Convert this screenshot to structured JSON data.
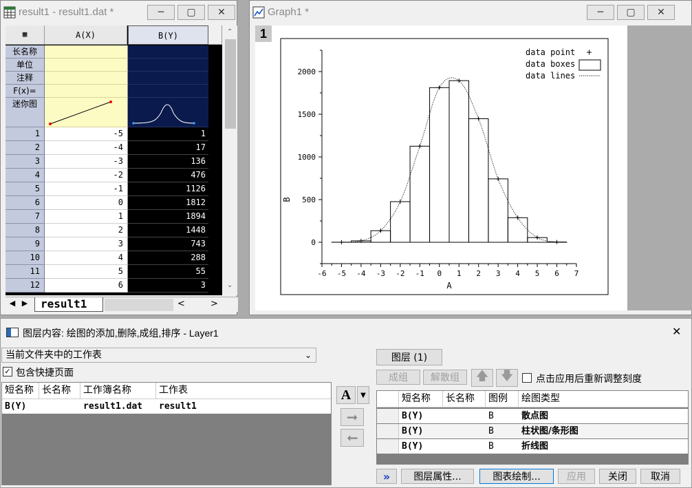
{
  "worksheet": {
    "title": "result1 - result1.dat *",
    "col_a": "A(X)",
    "col_b": "B(Y)",
    "meta_labels": [
      "长名称",
      "单位",
      "注释",
      "F(x)=",
      "迷你图"
    ],
    "rows": [
      {
        "n": "1",
        "a": "-5",
        "b": "1"
      },
      {
        "n": "2",
        "a": "-4",
        "b": "17"
      },
      {
        "n": "3",
        "a": "-3",
        "b": "136"
      },
      {
        "n": "4",
        "a": "-2",
        "b": "476"
      },
      {
        "n": "5",
        "a": "-1",
        "b": "1126"
      },
      {
        "n": "6",
        "a": "0",
        "b": "1812"
      },
      {
        "n": "7",
        "a": "1",
        "b": "1894"
      },
      {
        "n": "8",
        "a": "2",
        "b": "1448"
      },
      {
        "n": "9",
        "a": "3",
        "b": "743"
      },
      {
        "n": "10",
        "a": "4",
        "b": "288"
      },
      {
        "n": "11",
        "a": "5",
        "b": "55"
      },
      {
        "n": "12",
        "a": "6",
        "b": "3"
      }
    ],
    "sheet_tab": "result1"
  },
  "graph": {
    "title": "Graph1 *",
    "layer_badge": "1"
  },
  "chart_data": {
    "type": "bar",
    "x": [
      -5,
      -4,
      -3,
      -2,
      -1,
      0,
      1,
      2,
      3,
      4,
      5,
      6
    ],
    "series": [
      {
        "name": "data point",
        "values": [
          1,
          17,
          136,
          476,
          1126,
          1812,
          1894,
          1448,
          743,
          288,
          55,
          3
        ]
      },
      {
        "name": "data boxes",
        "values": [
          1,
          17,
          136,
          476,
          1126,
          1812,
          1894,
          1448,
          743,
          288,
          55,
          3
        ]
      },
      {
        "name": "data lines",
        "values": [
          1,
          17,
          136,
          476,
          1126,
          1812,
          1894,
          1448,
          743,
          288,
          55,
          3
        ]
      }
    ],
    "xlabel": "A",
    "ylabel": "B",
    "xlim": [
      -6,
      7
    ],
    "ylim": [
      -250,
      2250
    ],
    "xticks": [
      "-6",
      "-5",
      "-4",
      "-3",
      "-2",
      "-1",
      "0",
      "1",
      "2",
      "3",
      "4",
      "5",
      "6",
      "7"
    ],
    "yticks": [
      "0",
      "500",
      "1000",
      "1500",
      "2000"
    ],
    "legend_position": "top-right",
    "grid": false
  },
  "dialog": {
    "title": "图层内容: 绘图的添加,删除,成组,排序 - Layer1",
    "source_select": "当前文件夹中的工作表",
    "include_shortcut": "包含快捷页面",
    "left_headers": [
      "短名称",
      "长名称",
      "工作簿名称",
      "工作表"
    ],
    "left_rows": [
      {
        "short": "B(Y)",
        "long": "",
        "book": "result1.dat",
        "sheet": "result1"
      }
    ],
    "layer_button": "图层 (1)",
    "group_button": "成组",
    "ungroup_button": "解散组",
    "rescale_label": "点击应用后重新调整刻度",
    "right_headers": [
      "短名称",
      "长名称",
      "图例",
      "绘图类型"
    ],
    "right_rows": [
      {
        "short": "B(Y)",
        "long": "",
        "legend": "B",
        "type": "散点图"
      },
      {
        "short": "B(Y)",
        "long": "",
        "legend": "B",
        "type": "柱状图/条形图"
      },
      {
        "short": "B(Y)",
        "long": "",
        "legend": "B",
        "type": "折线图"
      }
    ],
    "expand_button": "»",
    "layer_props_button": "图层属性...",
    "plot_setup_button": "图表绘制...",
    "apply_button": "应用",
    "close_button": "关闭",
    "cancel_button": "取消"
  }
}
